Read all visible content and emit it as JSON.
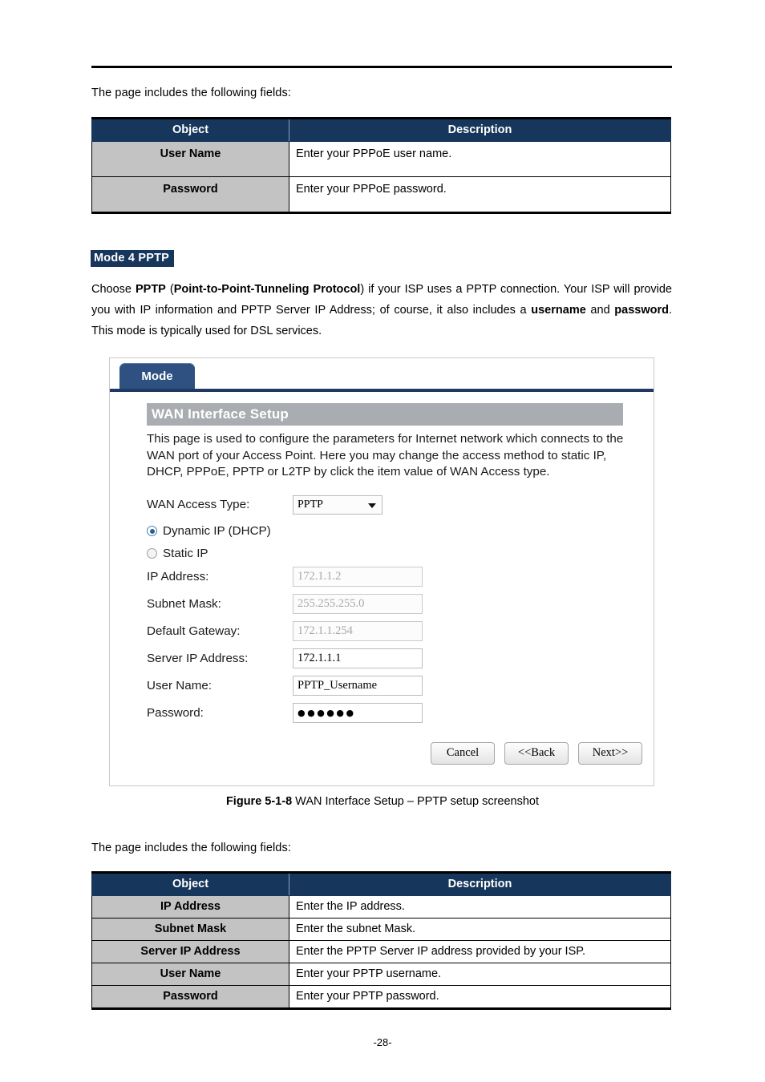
{
  "document": {
    "intro_text": "The page includes the following fields:",
    "page_number": "-28-"
  },
  "table_top": {
    "headers": [
      "Object",
      "Description"
    ],
    "rows": [
      {
        "object": "User Name",
        "description": "Enter your PPPoE user name."
      },
      {
        "object": "Password",
        "description": "Enter your PPPoE password."
      }
    ]
  },
  "section": {
    "heading": "Mode 4 PPTP",
    "paragraph": {
      "p1": "Choose ",
      "b1": "PPTP",
      "p2": " (",
      "b2": "Point-to-Point-Tunneling Protocol",
      "p3": ") if your ISP uses a PPTP connection. Your ISP will provide you with IP information and PPTP Server IP Address; of course, it also includes a ",
      "b3": "username",
      "p4": " and ",
      "b4": "password",
      "p5": ". This mode is typically used for DSL services."
    }
  },
  "router_ui": {
    "tab_label": "Mode",
    "section_title": "WAN Interface Setup",
    "section_description": "This page is used to configure the parameters for Internet network which connects to the WAN port of your Access Point. Here you may change the access method to static IP, DHCP, PPPoE, PPTP or L2TP by click the item value of WAN Access type.",
    "wan_access_type": {
      "label": "WAN Access Type:",
      "value": "PPTP"
    },
    "radios": [
      {
        "label": "Dynamic IP (DHCP)",
        "selected": true
      },
      {
        "label": "Static IP",
        "selected": false
      }
    ],
    "fields": [
      {
        "label": "IP Address:",
        "value": "172.1.1.2",
        "disabled": true
      },
      {
        "label": "Subnet Mask:",
        "value": "255.255.255.0",
        "disabled": true
      },
      {
        "label": "Default Gateway:",
        "value": "172.1.1.254",
        "disabled": true
      },
      {
        "label": "Server IP Address:",
        "value": "172.1.1.1",
        "disabled": false
      },
      {
        "label": "User Name:",
        "value": "PPTP_Username",
        "disabled": false
      },
      {
        "label": "Password:",
        "value": "●●●●●●",
        "disabled": false
      }
    ],
    "buttons": [
      "Cancel",
      "<<Back",
      "Next>>"
    ]
  },
  "figure": {
    "number": "Figure 5-1-8",
    "caption": " WAN Interface Setup – PPTP setup screenshot"
  },
  "table_bottom": {
    "headers": [
      "Object",
      "Description"
    ],
    "rows": [
      {
        "object": "IP Address",
        "description": "Enter the IP address."
      },
      {
        "object": "Subnet Mask",
        "description": "Enter the subnet Mask."
      },
      {
        "object": "Server IP Address",
        "description": "Enter the PPTP Server IP address provided by your ISP."
      },
      {
        "object": "User Name",
        "description": "Enter your PPTP username."
      },
      {
        "object": "Password",
        "description": "Enter your PPTP password."
      }
    ]
  },
  "colors": {
    "header_navy": "#16365c",
    "tab_navy": "#2e5181",
    "tab_underline": "#1f3864",
    "cell_gray": "#c3c3c3",
    "section_bar_gray": "#a9adb1"
  }
}
